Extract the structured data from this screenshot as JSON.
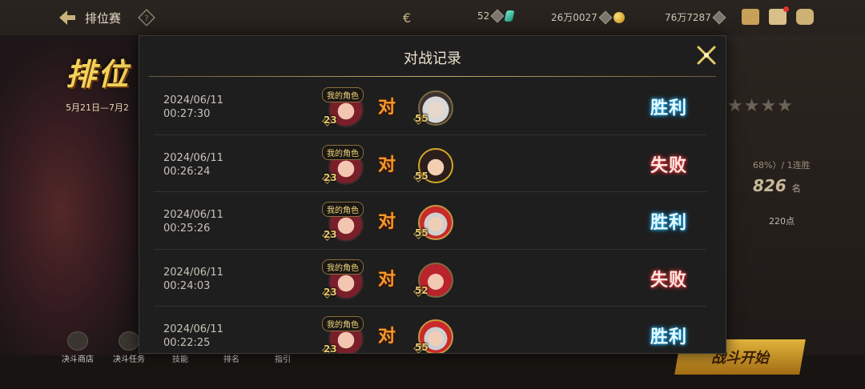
{
  "topbar": {
    "title": "排位赛",
    "currencies": [
      {
        "value": "52",
        "icon": "gem-icon"
      },
      {
        "value": "26万0027",
        "icon": "gold-coin-icon"
      },
      {
        "value": "76万7287",
        "icon": "chest-icon"
      }
    ]
  },
  "background": {
    "event_title": "排位",
    "date_range": "5月21日—7月2",
    "rank_value": "826",
    "rank_unit": "名",
    "win_info": "68%）/ 1连胜",
    "score": "220点",
    "start_button": "战斗开始",
    "bottom_nav": [
      "决斗商店",
      "决斗任务",
      "技能",
      "排名",
      "指引"
    ]
  },
  "modal": {
    "title": "对战记录",
    "my_tag": "我的角色",
    "vs_label": "对",
    "records": [
      {
        "date": "2024/06/11",
        "time": "00:27:30",
        "my_level": "23",
        "opp_level": "55",
        "opp_style": "white",
        "result": "胜利",
        "result_type": "win"
      },
      {
        "date": "2024/06/11",
        "time": "00:26:24",
        "my_level": "23",
        "opp_level": "55",
        "opp_style": "black gold",
        "result": "失败",
        "result_type": "lose"
      },
      {
        "date": "2024/06/11",
        "time": "00:25:26",
        "my_level": "23",
        "opp_level": "55",
        "opp_style": "santa",
        "result": "胜利",
        "result_type": "win"
      },
      {
        "date": "2024/06/11",
        "time": "00:24:03",
        "my_level": "23",
        "opp_level": "52",
        "opp_style": "red",
        "result": "失败",
        "result_type": "lose"
      },
      {
        "date": "2024/06/11",
        "time": "00:22:25",
        "my_level": "23",
        "opp_level": "55",
        "opp_style": "santa",
        "result": "胜利",
        "result_type": "win"
      }
    ]
  },
  "colors": {
    "win": "#2bb1e8",
    "lose": "#e2474a",
    "vs": "#f39a2c",
    "accent_gold": "#c8a96a"
  }
}
